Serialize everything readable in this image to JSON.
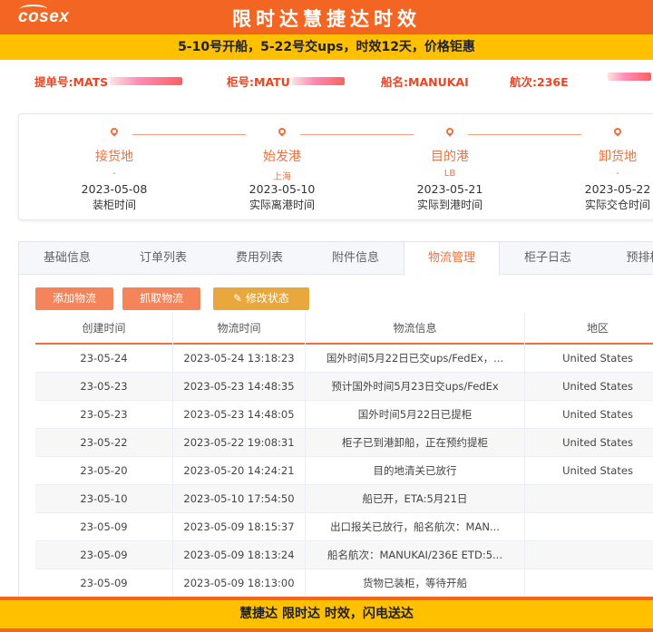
{
  "banner": {
    "logo": "cosex",
    "title": "限时达慧捷达时效"
  },
  "promo": "5-10号开船，5-22号交ups，时效12天，价格钜惠",
  "info": {
    "bill_label": "提单号:MATS",
    "container_label": "柜号:MATU",
    "ship_label": "船名:MANUKAI",
    "voyage_label": "航次:236E"
  },
  "route": [
    {
      "name": "接货地",
      "sub": "-",
      "date": "2023-05-08",
      "label": "装柜时间"
    },
    {
      "name": "始发港",
      "sub": "上海",
      "date": "2023-05-10",
      "label": "实际离港时间"
    },
    {
      "name": "目的港",
      "sub": "LB",
      "date": "2023-05-21",
      "label": "实际到港时间"
    },
    {
      "name": "卸货地",
      "sub": "-",
      "date": "2023-05-22",
      "label": "实际交仓时间"
    }
  ],
  "tabs": [
    "基础信息",
    "订单列表",
    "费用列表",
    "附件信息",
    "物流管理",
    "柜子日志",
    "预排柜"
  ],
  "active_tab": "物流管理",
  "buttons": {
    "add": "添加物流",
    "fetch": "抓取物流",
    "edit": "修改状态"
  },
  "table": {
    "headers": [
      "创建时间",
      "物流时间",
      "物流信息",
      "地区"
    ],
    "rows": [
      [
        "23-05-24",
        "2023-05-24 13:18:23",
        "国外时间5月22日已交ups/FedEx，...",
        "United States"
      ],
      [
        "23-05-23",
        "2023-05-23 14:48:35",
        "预计国外时间5月23日交ups/FedEx",
        "United States"
      ],
      [
        "23-05-23",
        "2023-05-23 14:48:05",
        "国外时间5月22日已提柜",
        "United States"
      ],
      [
        "23-05-22",
        "2023-05-22 19:08:31",
        "柜子已到港卸船，正在预约提柜",
        "United States"
      ],
      [
        "23-05-20",
        "2023-05-20 14:24:21",
        "目的地清关已放行",
        "United States"
      ],
      [
        "23-05-10",
        "2023-05-10 17:54:50",
        "船已开，ETA:5月21日",
        ""
      ],
      [
        "23-05-09",
        "2023-05-09 18:15:37",
        "出口报关已放行，船名航次：MAN...",
        ""
      ],
      [
        "23-05-09",
        "2023-05-09 18:13:24",
        "船名航次：MANUKAI/236E ETD:5...",
        ""
      ],
      [
        "23-05-09",
        "2023-05-09 18:13:00",
        "货物已装柜，等待开船",
        ""
      ]
    ]
  },
  "footer": "慧捷达 限时达 时效，闪电送达",
  "colors": {
    "brand_orange": "#f26522",
    "accent_orange": "#f26f3c",
    "banner_yellow": "#ffc000",
    "button_gold": "#e9a83e"
  }
}
